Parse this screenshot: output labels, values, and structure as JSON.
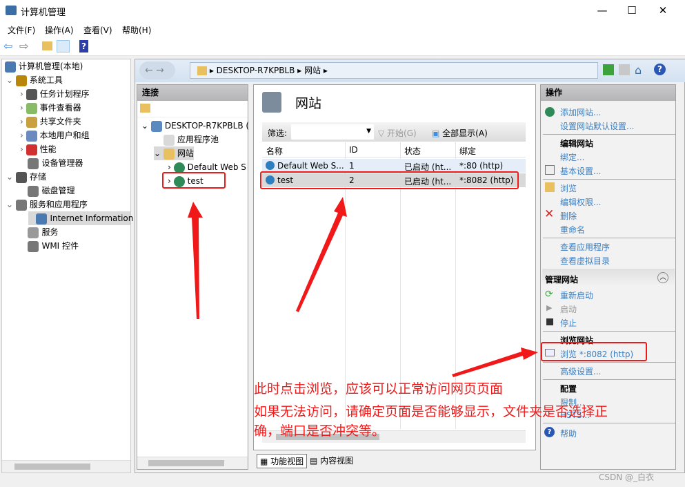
{
  "window": {
    "title": "计算机管理",
    "controls": [
      "minimize",
      "maximize",
      "close"
    ]
  },
  "menu": [
    "文件(F)",
    "操作(A)",
    "查看(V)",
    "帮助(H)"
  ],
  "tree": {
    "root": "计算机管理(本地)",
    "items": [
      {
        "label": "系统工具",
        "level": 1
      },
      {
        "label": "任务计划程序",
        "level": 2
      },
      {
        "label": "事件查看器",
        "level": 2
      },
      {
        "label": "共享文件夹",
        "level": 2
      },
      {
        "label": "本地用户和组",
        "level": 2
      },
      {
        "label": "性能",
        "level": 2
      },
      {
        "label": "设备管理器",
        "level": 2
      },
      {
        "label": "存储",
        "level": 1
      },
      {
        "label": "磁盘管理",
        "level": 2
      },
      {
        "label": "服务和应用程序",
        "level": 1
      },
      {
        "label": "Internet Information S",
        "level": 2
      },
      {
        "label": "服务",
        "level": 2
      },
      {
        "label": "WMI 控件",
        "level": 2
      }
    ]
  },
  "address": {
    "segments": [
      "DESKTOP-R7KPBLB",
      "网站"
    ]
  },
  "connections": {
    "header": "连接",
    "items": [
      "DESKTOP-R7KPBLB (",
      "应用程序池",
      "网站",
      "Default Web S",
      "test"
    ]
  },
  "center": {
    "title": "网站",
    "filter_label": "筛选:",
    "filter_value": "",
    "start_label": "开始(G)",
    "show_all_label": "全部显示(A)",
    "columns": [
      "名称",
      "ID",
      "状态",
      "绑定"
    ],
    "rows": [
      [
        "Default Web S...",
        "1",
        "已启动 (ht...",
        "*:80 (http)"
      ],
      [
        "test",
        "2",
        "已启动 (ht...",
        "*:8082 (http)"
      ]
    ],
    "tabs": [
      "功能视图",
      "内容视图"
    ]
  },
  "actions": {
    "header": "操作",
    "add_site": "添加网站...",
    "site_defaults": "设置网站默认设置...",
    "edit_site": "编辑网站",
    "bindings": "绑定...",
    "basic_settings": "基本设置...",
    "browse": "浏览",
    "edit_permissions": "编辑权限...",
    "delete": "删除",
    "rename": "重命名",
    "view_apps": "查看应用程序",
    "view_vdirs": "查看虚拟目录",
    "manage_site": "管理网站",
    "restart": "重新启动",
    "start": "启动",
    "stop": "停止",
    "browse_site": "浏览网站",
    "browse_8082": "浏览 *:8082 (http)",
    "advanced": "高级设置...",
    "config": "配置",
    "limits": "限制...",
    "hsts": "HSTS...",
    "help": "帮助"
  },
  "annotations": {
    "line1": "此时点击浏览，应该可以正常访问网页页面",
    "line2": "如果无法访问，请确定页面是否能够显示，文件夹是否选择正",
    "line3": "确，端口是否冲突等。",
    "color": "#f01818"
  },
  "watermark": "CSDN @_白衣"
}
